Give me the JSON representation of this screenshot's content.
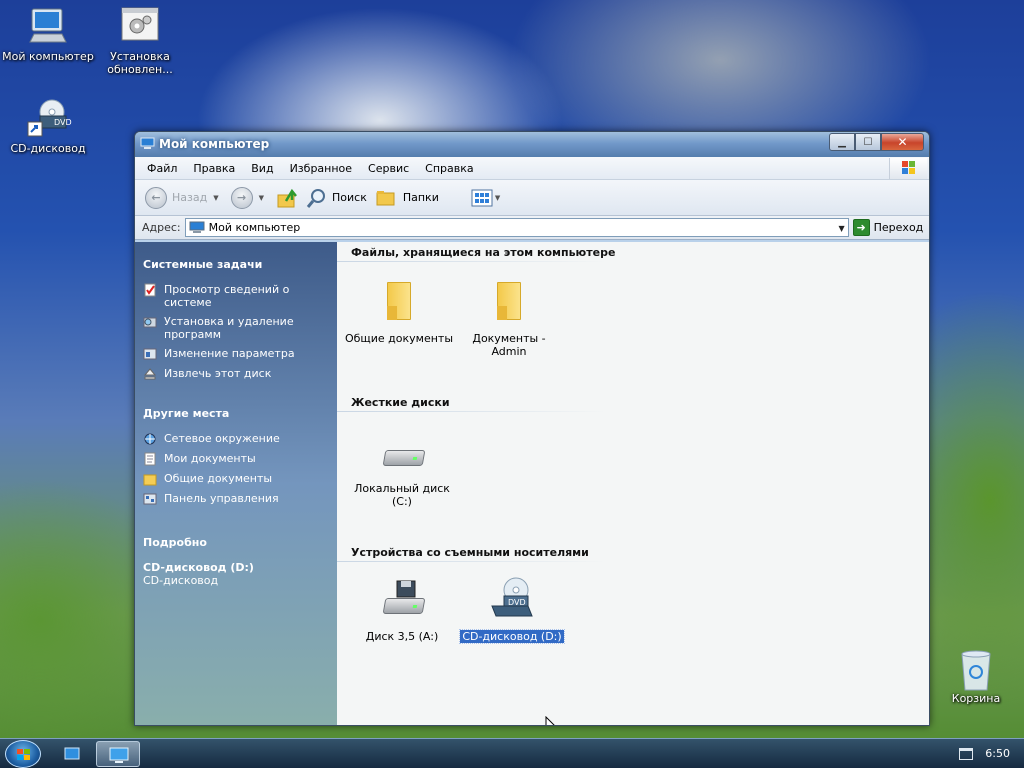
{
  "desktop": {
    "icons": [
      {
        "label": "Мой компьютер"
      },
      {
        "label": "Установка обновлен..."
      },
      {
        "label": "CD-дисковод"
      },
      {
        "label": "Корзина"
      }
    ],
    "dvd_badge": "DVD"
  },
  "window": {
    "title": "Мой компьютер",
    "menu": [
      "Файл",
      "Правка",
      "Вид",
      "Избранное",
      "Сервис",
      "Справка"
    ],
    "toolbar": {
      "back_label": "Назад",
      "search_label": "Поиск",
      "folders_label": "Папки"
    },
    "address": {
      "label": "Адрес:",
      "value": "Мой компьютер",
      "go_label": "Переход"
    },
    "sidebar": {
      "system_tasks": {
        "title": "Системные задачи",
        "items": [
          "Просмотр сведений о системе",
          "Установка и удаление программ",
          "Изменение параметра",
          "Извлечь этот диск"
        ]
      },
      "other_places": {
        "title": "Другие места",
        "items": [
          "Сетевое окружение",
          "Мои документы",
          "Общие документы",
          "Панель управления"
        ]
      },
      "details": {
        "title": "Подробно",
        "name": "CD-дисковод (D:)",
        "type": "CD-дисковод"
      }
    },
    "main": {
      "groups": [
        {
          "title": "Файлы, хранящиеся на этом компьютере",
          "items": [
            "Общие документы",
            "Документы - Admin"
          ]
        },
        {
          "title": "Жесткие диски",
          "items": [
            "Локальный диск (C:)"
          ]
        },
        {
          "title": "Устройства со съемными носителями",
          "items": [
            "Диск 3,5 (A:)",
            "CD-дисковод (D:)"
          ]
        }
      ]
    }
  },
  "taskbar": {
    "clock": "6:50"
  },
  "colors": {
    "selection": "#316ac5",
    "sidebar_text": "#ffffff",
    "close_button": "#c8442b"
  }
}
